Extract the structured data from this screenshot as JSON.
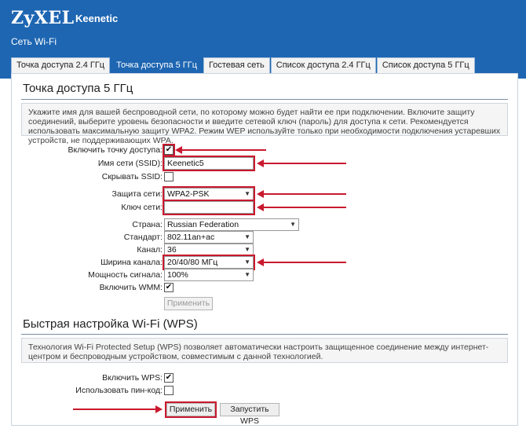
{
  "header": {
    "logo": "ZyXEL",
    "product": "Keenetic",
    "section": "Сеть Wi-Fi"
  },
  "tabs": [
    {
      "label": "Точка доступа 2.4 ГГц"
    },
    {
      "label": "Точка доступа 5 ГГц"
    },
    {
      "label": "Гостевая сеть"
    },
    {
      "label": "Список доступа 2.4 ГГц"
    },
    {
      "label": "Список доступа 5 ГГц"
    }
  ],
  "ap5": {
    "title": "Точка доступа 5 ГГц",
    "info": "Укажите имя для вашей беспроводной сети, по которому можно будет найти ее при подключении. Включите защиту соединений, выберите уровень безопасности и введите сетевой ключ (пароль) для доступа к сети. Рекомендуется использовать максимальную защиту WPA2. Режим WEP используйте только при необходимости подключения устаревших устройств, не поддерживающих WPA.",
    "enable_label": "Включить точку доступа:",
    "enable_check": "✔",
    "ssid_label": "Имя сети (SSID):",
    "ssid_value": "Keenetic5",
    "hide_ssid_label": "Скрывать SSID:",
    "security_label": "Защита сети:",
    "security_value": "WPA2-PSK",
    "key_label": "Ключ сети:",
    "key_value": "",
    "country_label": "Страна:",
    "country_value": "Russian Federation",
    "standard_label": "Стандарт:",
    "standard_value": "802.11an+ac",
    "channel_label": "Канал:",
    "channel_value": "36",
    "width_label": "Ширина канала:",
    "width_value": "20/40/80 МГц",
    "power_label": "Мощность сигнала:",
    "power_value": "100%",
    "wmm_label": "Включить WMM:",
    "wmm_check": "✔",
    "apply_label": "Применить"
  },
  "wps": {
    "title": "Быстрая настройка Wi-Fi (WPS)",
    "info": "Технология Wi-Fi Protected Setup (WPS) позволяет автоматически настроить защищенное соединение между интернет-центром и беспроводным устройством, совместимым с данной технологией.",
    "enable_label": "Включить WPS:",
    "enable_check": "✔",
    "pin_label": "Использовать пин-код:",
    "apply_label": "Применить",
    "start_label": "Запустить WPS"
  },
  "colors": {
    "header_blue": "#1e66b2",
    "highlight_red": "#c9192e"
  }
}
